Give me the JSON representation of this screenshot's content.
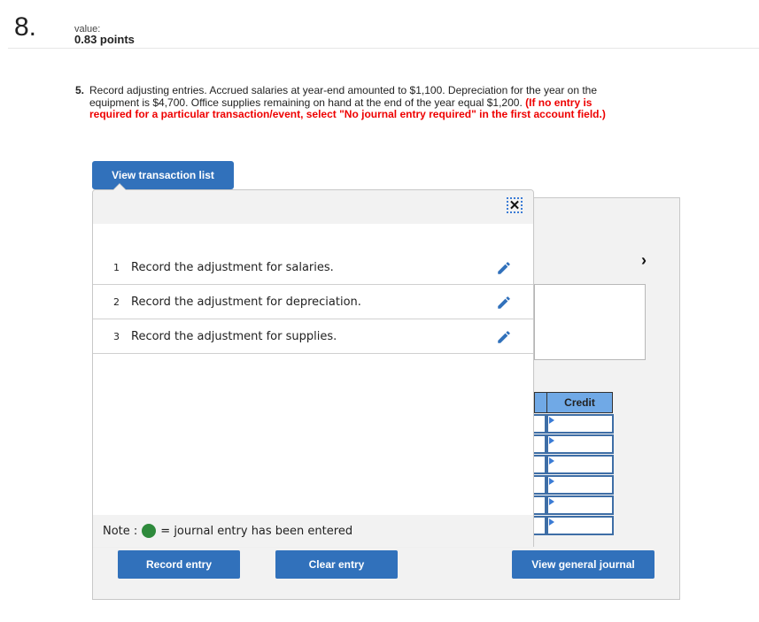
{
  "header": {
    "question_number": "8.",
    "value_label": "value:",
    "value_points": "0.83 points"
  },
  "question": {
    "number": "5.",
    "text": "Record adjusting entries. Accrued salaries at year-end amounted to $1,100. Depreciation for the year on the equipment is $4,700. Office supplies remaining on hand at the end of the year equal $1,200.",
    "instruction": "(If no entry is required for a particular transaction/event, select \"No journal entry required\" in the first account field.)"
  },
  "buttons": {
    "view_transaction_list": "View transaction list",
    "record_entry": "Record entry",
    "clear_entry": "Clear entry",
    "view_general_journal": "View general journal"
  },
  "transaction_list": {
    "close_icon": "close-icon",
    "items": [
      {
        "num": "1",
        "label": "Record the adjustment for salaries.",
        "icon": "pencil-icon"
      },
      {
        "num": "2",
        "label": "Record the adjustment for depreciation.",
        "icon": "pencil-icon"
      },
      {
        "num": "3",
        "label": "Record the adjustment for supplies.",
        "icon": "pencil-icon"
      }
    ]
  },
  "note": {
    "prefix": "Note :",
    "suffix": "= journal entry has been entered"
  },
  "journal": {
    "credit_header": "Credit",
    "rows": 6,
    "next_icon": "›"
  },
  "colors": {
    "accent": "#3171bb",
    "instruction_red": "#ee0000",
    "entered_green": "#2e8a3c",
    "header_blue": "#70a9e6"
  }
}
